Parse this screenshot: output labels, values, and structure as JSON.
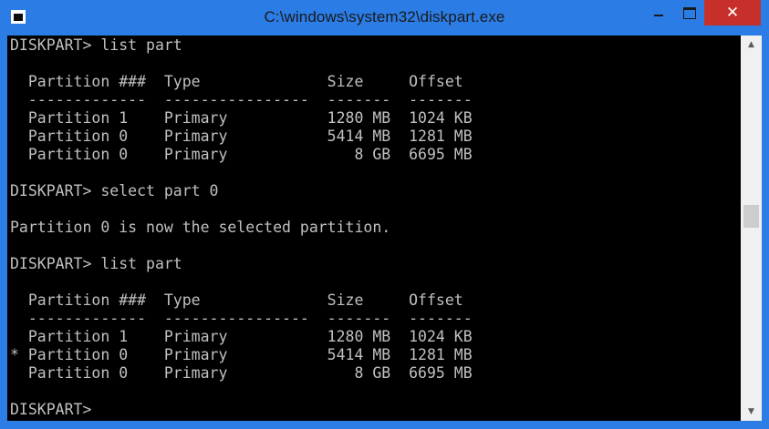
{
  "window": {
    "title": "C:\\windows\\system32\\diskpart.exe",
    "close_glyph": "✕"
  },
  "icons": {
    "app": "console-app-icon",
    "minimize": "minimize-icon",
    "maximize": "maximize-icon",
    "close": "close-icon",
    "scroll_up": "chevron-up-icon",
    "scroll_down": "chevron-down-icon"
  },
  "colors": {
    "titlebar": "#2b7ce5",
    "close_button": "#c7302a",
    "console_bg": "#000000",
    "console_text": "#c0c0c0"
  },
  "console": {
    "lines": [
      "DISKPART> list part",
      "",
      "  Partition ###  Type              Size     Offset",
      "  -------------  ----------------  -------  -------",
      "  Partition 1    Primary           1280 MB  1024 KB",
      "  Partition 0    Primary           5414 MB  1281 MB",
      "  Partition 0    Primary              8 GB  6695 MB",
      "",
      "DISKPART> select part 0",
      "",
      "Partition 0 is now the selected partition.",
      "",
      "DISKPART> list part",
      "",
      "  Partition ###  Type              Size     Offset",
      "  -------------  ----------------  -------  -------",
      "  Partition 1    Primary           1280 MB  1024 KB",
      "* Partition 0    Primary           5414 MB  1281 MB",
      "  Partition 0    Primary              8 GB  6695 MB",
      "",
      "DISKPART>"
    ]
  },
  "scrollbar": {
    "up_glyph": "▲",
    "down_glyph": "▼"
  }
}
